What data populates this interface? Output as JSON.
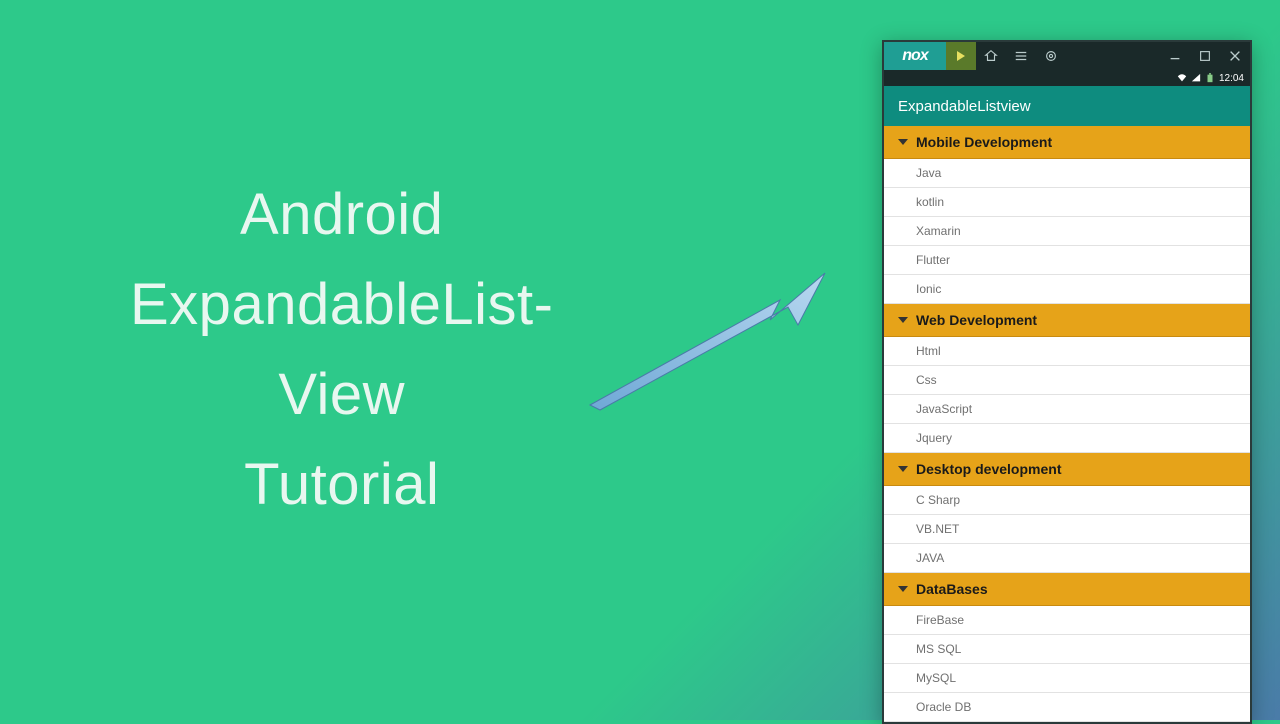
{
  "title": {
    "line1": "Android",
    "line2": "ExpandableList-",
    "line3": "View",
    "line4": "Tutorial"
  },
  "emulator": {
    "logo": "nox",
    "status_time": "12:04",
    "app_title": "ExpandableListview",
    "groups": [
      {
        "label": "Mobile Development",
        "children": [
          "Java",
          "kotlin",
          "Xamarin",
          "Flutter",
          "Ionic"
        ]
      },
      {
        "label": "Web Development",
        "children": [
          "Html",
          "Css",
          "JavaScript",
          "Jquery"
        ]
      },
      {
        "label": "Desktop development",
        "children": [
          "C Sharp",
          "VB.NET",
          "JAVA"
        ]
      },
      {
        "label": "DataBases",
        "children": [
          "FireBase",
          "MS SQL",
          "MySQL",
          "Oracle DB"
        ]
      }
    ]
  }
}
